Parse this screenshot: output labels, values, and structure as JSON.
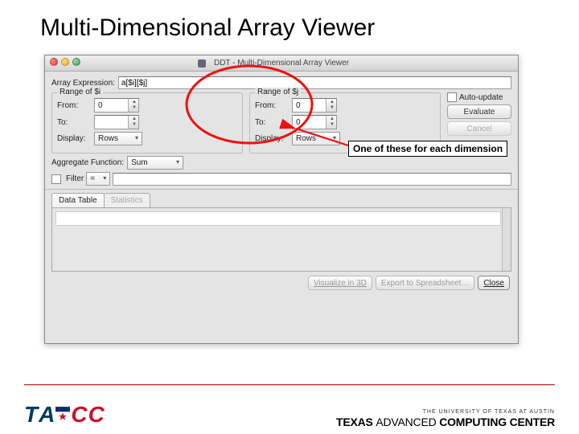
{
  "slide": {
    "title": "Multi-Dimensional Array Viewer"
  },
  "window": {
    "title": "DDT - Multi-Dimensional Array Viewer"
  },
  "expr": {
    "label": "Array Expression:",
    "value": "a[$i][$j]"
  },
  "range_i": {
    "legend": "Range of $i",
    "from_label": "From:",
    "from_value": "0",
    "to_label": "To:",
    "to_value": "",
    "display_label": "Display:",
    "display_value": "Rows"
  },
  "range_j": {
    "legend": "Range of $j",
    "from_label": "From:",
    "from_value": "0",
    "to_label": "To:",
    "to_value": "0",
    "display_label": "Display:",
    "display_value": "Rows"
  },
  "auto_update": {
    "label": "Auto-update"
  },
  "buttons": {
    "evaluate": "Evaluate",
    "cancel": "Cancel",
    "visualize": "Visualize in 3D",
    "export": "Export to Spreadsheet…",
    "close": "Close"
  },
  "aggregate": {
    "label": "Aggregate Function:",
    "value": "Sum"
  },
  "filter": {
    "label": "Filter",
    "op": "=",
    "value": ""
  },
  "tabs": {
    "data": "Data Table",
    "stats": "Statistics"
  },
  "callout": {
    "text": "One of these for each dimension"
  },
  "footer": {
    "tacc_short": "TACC",
    "univ": "THE UNIVERSITY OF TEXAS AT AUSTIN",
    "tacc_full_a": "TEXAS ",
    "tacc_full_b": "ADVANCED",
    "tacc_full_c": " COMPUTING CENTER"
  }
}
